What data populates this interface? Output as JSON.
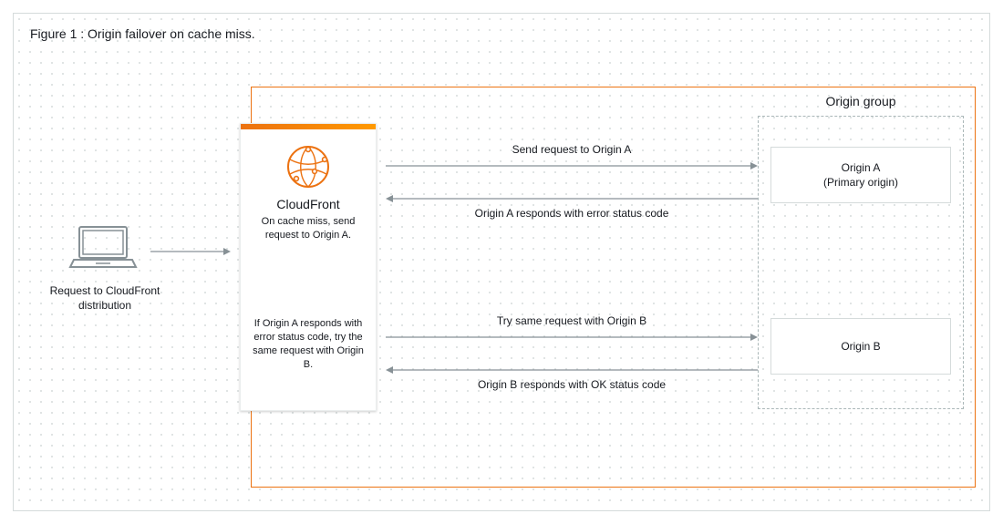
{
  "figure": {
    "title": "Figure 1 : Origin failover on cache miss."
  },
  "client": {
    "label": "Request to CloudFront distribution"
  },
  "cloudfront": {
    "title": "CloudFront",
    "subtitle1": "On cache miss, send request to Origin A.",
    "subtitle2": "If Origin A responds with error status code, try the same request with Origin B."
  },
  "group": {
    "title": "Origin group",
    "originA": {
      "line1": "Origin A",
      "line2": "(Primary origin)"
    },
    "originB": {
      "line1": "Origin B"
    }
  },
  "arrows": {
    "toA": "Send request to Origin A",
    "fromA": "Origin A responds with error status code",
    "toB": "Try same request with Origin B",
    "fromB": "Origin B responds with OK status code"
  }
}
